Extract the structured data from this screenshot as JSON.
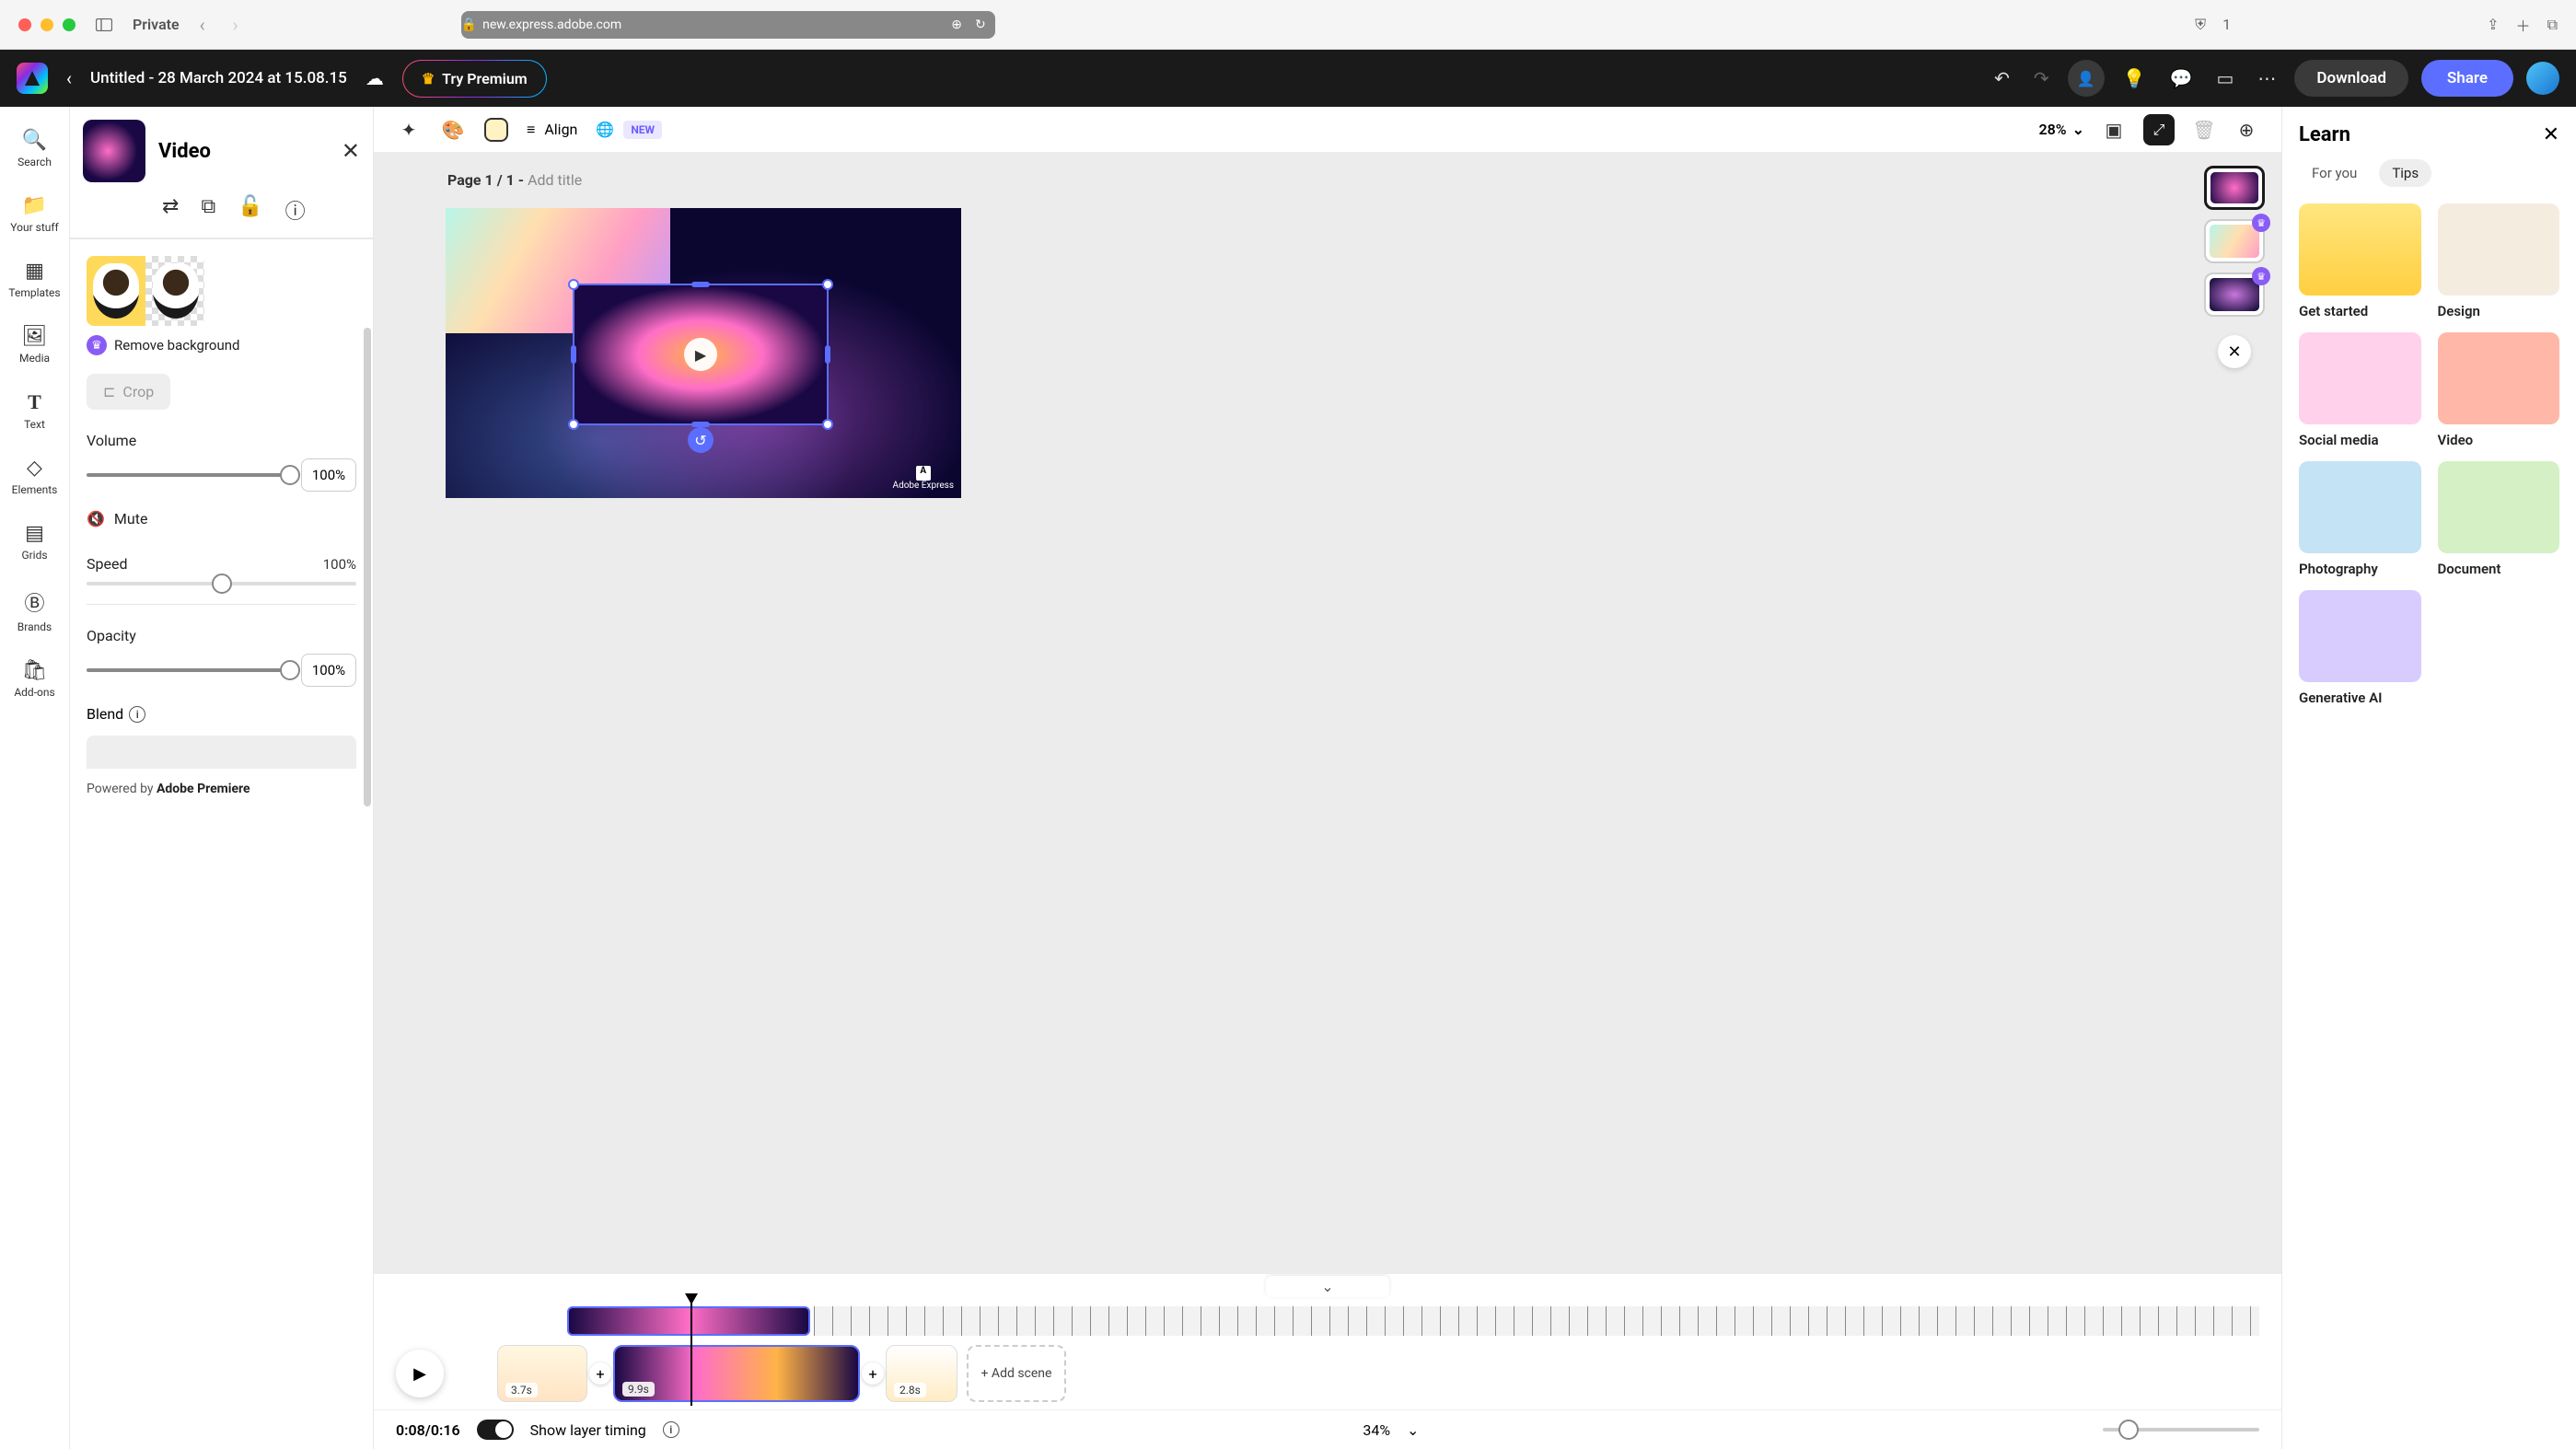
{
  "browser": {
    "private_label": "Private",
    "url": "new.express.adobe.com",
    "shield_count": "1"
  },
  "header": {
    "doc_title": "Untitled - 28 March 2024 at 15.08.15",
    "try_premium": "Try Premium",
    "download": "Download",
    "share": "Share"
  },
  "rail": {
    "search": "Search",
    "your_stuff": "Your stuff",
    "templates": "Templates",
    "media": "Media",
    "text": "Text",
    "elements": "Elements",
    "grids": "Grids",
    "brands": "Brands",
    "addons": "Add-ons"
  },
  "props": {
    "title": "Video",
    "remove_bg": "Remove background",
    "crop": "Crop",
    "volume_label": "Volume",
    "volume_value": "100%",
    "mute": "Mute",
    "speed_label": "Speed",
    "speed_value": "100%",
    "opacity_label": "Opacity",
    "opacity_value": "100%",
    "blend_label": "Blend",
    "powered_prefix": "Powered by ",
    "powered_brand": "Adobe Premiere"
  },
  "canvas_toolbar": {
    "align": "Align",
    "new_badge": "NEW",
    "zoom": "28%"
  },
  "canvas": {
    "page_label_strong": "Page 1 / 1 - ",
    "page_label_muted": "Add title",
    "watermark": "Adobe Express"
  },
  "timeline": {
    "scene1_dur": "3.7s",
    "scene2_dur": "9.9s",
    "scene3_dur": "2.8s",
    "add_scene": "+ Add scene",
    "time": "0:08/0:16",
    "layer_timing": "Show layer timing",
    "zoom": "34%"
  },
  "learn": {
    "title": "Learn",
    "tab_for_you": "For you",
    "tab_tips": "Tips",
    "cards": {
      "get_started": "Get started",
      "design": "Design",
      "social": "Social media",
      "video": "Video",
      "photo": "Photography",
      "document": "Document",
      "genai": "Generative AI"
    }
  }
}
